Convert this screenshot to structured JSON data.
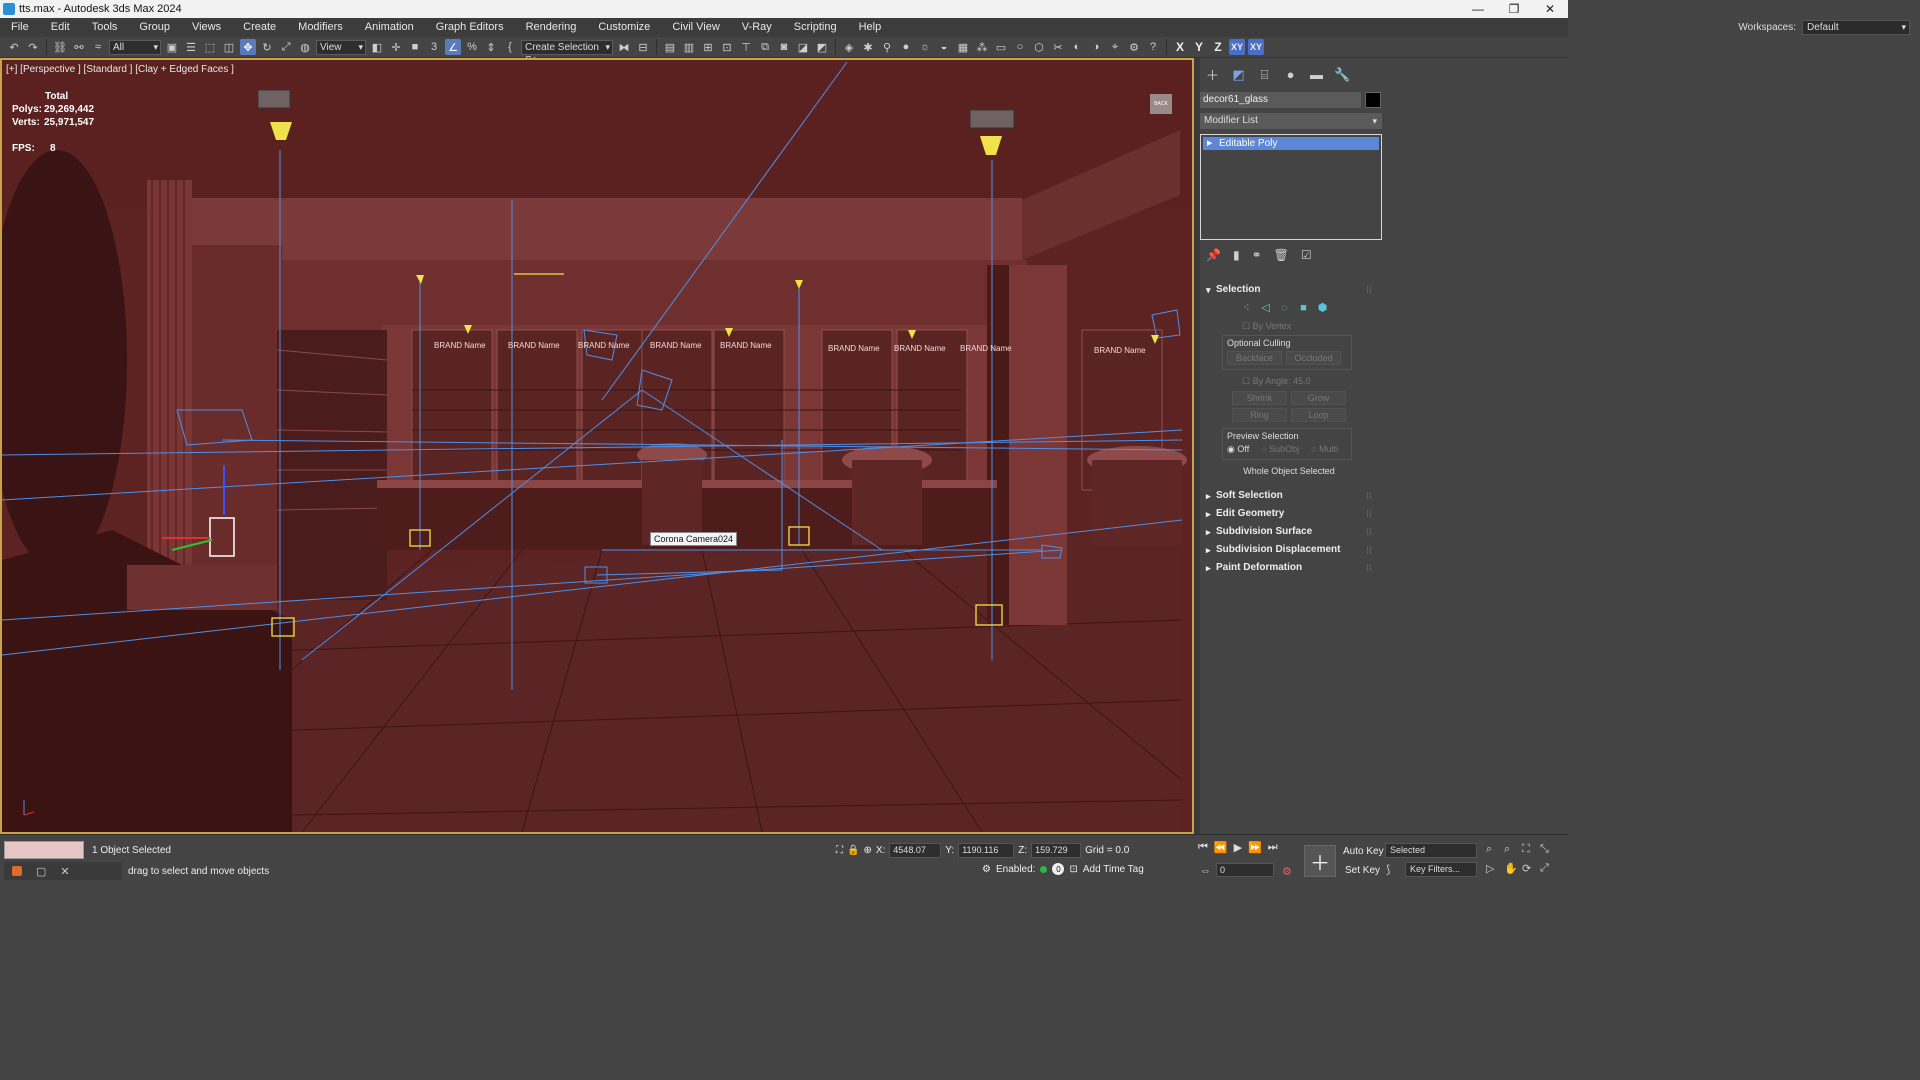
{
  "window": {
    "title": "tts.max - Autodesk 3ds Max 2024",
    "controls": [
      "—",
      "❐",
      "✕"
    ]
  },
  "menu": [
    "File",
    "Edit",
    "Tools",
    "Group",
    "Views",
    "Create",
    "Modifiers",
    "Animation",
    "Graph Editors",
    "Rendering",
    "Customize",
    "Civil View",
    "V-Ray",
    "Scripting",
    "Help"
  ],
  "workspaces": {
    "label": "Workspaces:",
    "value": "Default"
  },
  "toolbar": {
    "filter_value": "All",
    "refcoord_value": "View",
    "named_selection_placeholder": "Create Selection Se",
    "axes": [
      "X",
      "Y",
      "Z",
      "XY",
      "XY"
    ]
  },
  "viewport": {
    "label": "[+] [Perspective ] [Standard ] [Clay + Edged Faces ]",
    "stats": {
      "total_label": "Total",
      "polys_label": "Polys:",
      "polys_value": "29,269,442",
      "verts_label": "Verts:",
      "verts_value": "25,971,547",
      "fps_label": "FPS:",
      "fps_value": "8"
    },
    "tooltip": "Corona Camera024",
    "brand_labels": [
      "BRAND Name",
      "BRAND Name",
      "BRAND Name",
      "BRAND Name",
      "BRAND Name",
      "BRAND Name",
      "BRAND Name",
      "BRAND Name",
      "BRAND Name"
    ],
    "viewcube_label": "BACK",
    "colors": {
      "background": "#5d2322",
      "wire": "#4f8fe8",
      "light": "#f0e24a",
      "border": "#c9a24a"
    }
  },
  "command_panel": {
    "object_name": "decor61_glass",
    "modifier_list": "Modifier List",
    "stack_item": "Editable Poly",
    "selection": {
      "title": "Selection",
      "by_vertex": "By Vertex",
      "optional_culling": "Optional Culling",
      "backface": "Backface",
      "occluded": "Occluded",
      "by_angle": "By Angle:",
      "angle_value": "45.0",
      "shrink": "Shrink",
      "grow": "Grow",
      "ring": "Ring",
      "loop": "Loop",
      "preview_selection": "Preview Selection",
      "preview_off": "Off",
      "preview_subobj": "SubObj",
      "preview_multi": "Multi",
      "status": "Whole Object Selected"
    },
    "rollouts": [
      "Soft Selection",
      "Edit Geometry",
      "Subdivision Surface",
      "Subdivision Displacement",
      "Paint Deformation"
    ]
  },
  "status": {
    "selected": "1 Object Selected",
    "prompt": "drag to select and move objects",
    "x_label": "X:",
    "x_value": "4548.07",
    "y_label": "Y:",
    "y_value": "1190.116",
    "z_label": "Z:",
    "z_value": "159.729",
    "grid": "Grid = 0.0",
    "enabled_label": "Enabled:",
    "enabled_value": "0",
    "add_time_tag": "Add Time Tag",
    "frame_value": "0",
    "auto_key": "Auto Key",
    "set_key": "Set Key",
    "key_mode": "Selected",
    "key_filters": "Key Filters..."
  }
}
